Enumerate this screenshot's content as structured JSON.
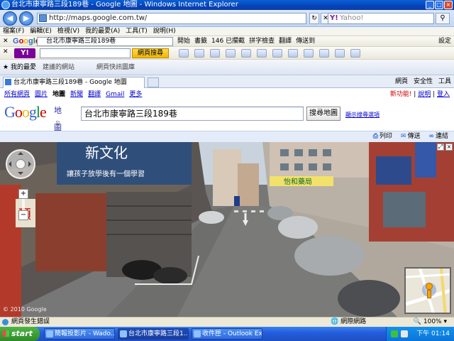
{
  "window": {
    "title": "台北市康寧路三段189巷 - Google 地圖 - Windows Internet Explorer"
  },
  "addressbar": {
    "url": "http://maps.google.com.tw/",
    "search_placeholder": "Yahoo!"
  },
  "menubar": {
    "items": [
      "檔案(F)",
      "編輯(E)",
      "檢視(V)",
      "我的最愛(A)",
      "工具(T)",
      "說明(H)"
    ]
  },
  "google_toolbar": {
    "logo": "Google",
    "query": "台北市康寧路三段189巷",
    "items": [
      "開始",
      "書籤",
      "146 已攔截",
      "拼字檢查",
      "翻譯",
      "傳送到"
    ],
    "settings": "設定"
  },
  "yahoo_toolbar": {
    "logo": "Y!",
    "search_button": "網頁搜尋"
  },
  "favorites": {
    "label": "我的最愛",
    "suggested": "建議的網站",
    "gallery": "網頁快訊圖庫"
  },
  "tab": {
    "title": "台北市康寧路三段189巷 - Google 地圖",
    "commands": [
      "網頁",
      "安全性",
      "工具"
    ]
  },
  "maps": {
    "nav_links": [
      "所有網頁",
      "圖片",
      "地圖",
      "新聞",
      "翻譯",
      "Gmail",
      "更多"
    ],
    "new_feature": "新功能!",
    "help": "說明",
    "login": "登入",
    "logo_maps": "地圖",
    "logo_region": "台灣",
    "query": "台北市康寧路三段189巷",
    "search_button": "搜尋地圖",
    "search_options": "顯示搜尋選項",
    "actions": [
      "列印",
      "傳送",
      "連結"
    ],
    "copyright": "© 2010 Google"
  },
  "streetview": {
    "sign_text": "新文化",
    "banner_text": "讓孩子放學後有一個學習",
    "shop_sign": "怡和藥局",
    "left_sign": "碩"
  },
  "statusbar": {
    "message": "網頁發生錯誤",
    "zone": "網際網路",
    "zoom": "100%"
  },
  "taskbar": {
    "start": "start",
    "tasks": [
      "簡報投影片 - Wado...",
      "台北市康寧路三段1...",
      "收件匣 - Outlook Exp..."
    ],
    "clock": "下午 01:14"
  },
  "colors": {
    "accent": "#3366cc",
    "taskbar": "#245edc",
    "titlebar": "#0543b8"
  }
}
